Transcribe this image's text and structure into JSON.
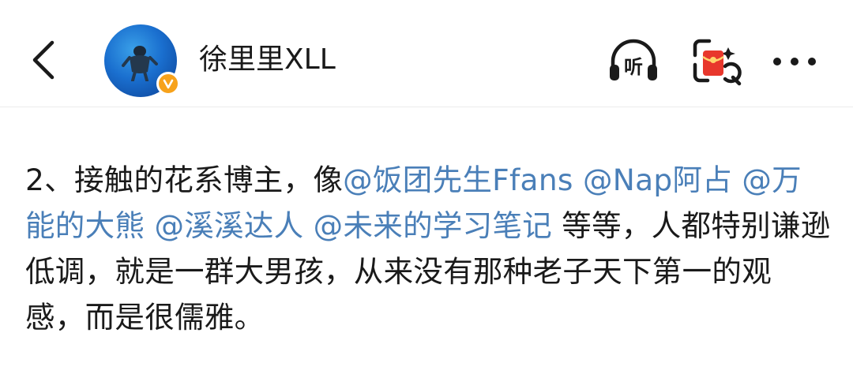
{
  "header": {
    "user_name": "徐里里XLL",
    "listen_label": "听",
    "colors": {
      "badge": "#f7a21b",
      "red_packet": "#e8372c",
      "mention": "#4a7fb8"
    }
  },
  "post": {
    "segments": [
      {
        "type": "text",
        "text": "2、接触的花系博主，像"
      },
      {
        "type": "mention",
        "text": "@饭团先生Ffans"
      },
      {
        "type": "text",
        "text": " "
      },
      {
        "type": "mention",
        "text": "@Nap阿占"
      },
      {
        "type": "text",
        "text": " "
      },
      {
        "type": "mention",
        "text": "@万能的大熊"
      },
      {
        "type": "text",
        "text": " "
      },
      {
        "type": "mention",
        "text": "@溪溪达人"
      },
      {
        "type": "text",
        "text": " "
      },
      {
        "type": "mention",
        "text": "@未来的学习笔记"
      },
      {
        "type": "text",
        "text": " 等等，人都特别谦逊低调，就是一群大男孩，从来没有那种老子天下第一的观感，而是很儒雅。"
      }
    ]
  }
}
